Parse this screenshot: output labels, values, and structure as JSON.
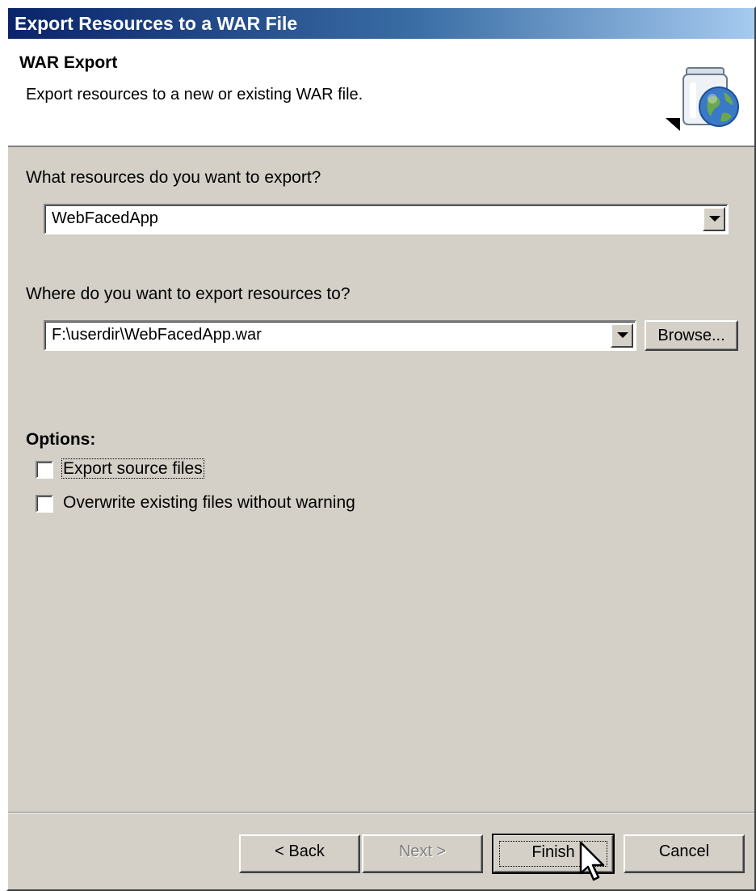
{
  "window": {
    "title": "Export Resources to a WAR File"
  },
  "banner": {
    "title": "WAR Export",
    "description": "Export resources to a new or existing WAR file.",
    "icon": "war-globe-icon"
  },
  "resources": {
    "question": "What resources do you want to export?",
    "selected": "WebFacedApp"
  },
  "destination": {
    "question": "Where do you want to export resources to?",
    "value": "F:\\userdir\\WebFacedApp.war",
    "browse_label": "Browse..."
  },
  "options": {
    "heading": "Options:",
    "items": [
      {
        "label": "Export source files",
        "checked": false
      },
      {
        "label": "Overwrite existing files without warning",
        "checked": false
      }
    ]
  },
  "buttons": {
    "back_label": "< Back",
    "next_label": "Next >",
    "finish_label": "Finish",
    "cancel_label": "Cancel"
  },
  "colors": {
    "title_start": "#0a246a",
    "title_end": "#a6caf0",
    "dialog_bg": "#d4d0c8"
  }
}
